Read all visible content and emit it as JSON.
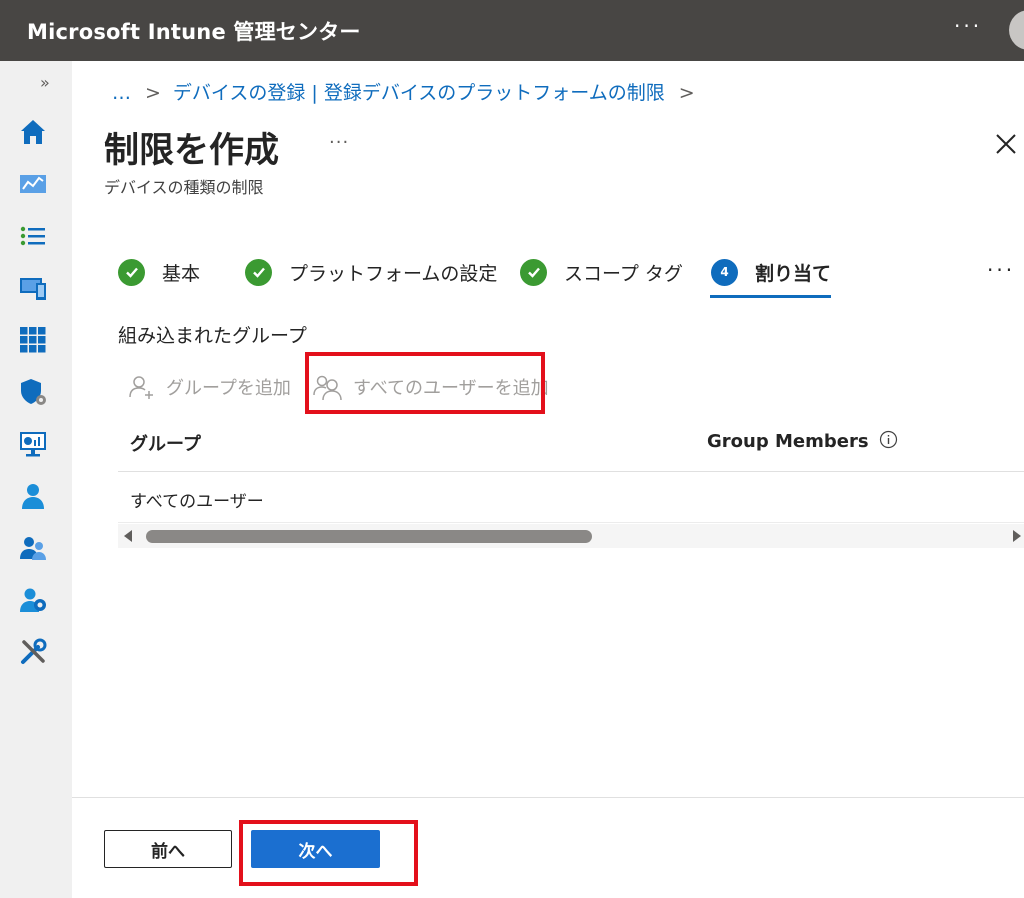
{
  "app": {
    "title": "Microsoft Intune 管理センター",
    "more": "···"
  },
  "nav": {
    "expand": "»",
    "icons": [
      "home-icon",
      "dashboard-icon",
      "all-services-icon",
      "devices-icon",
      "apps-icon",
      "endpoint-security-icon",
      "reports-icon",
      "users-icon",
      "groups-icon",
      "tenant-admin-icon",
      "troubleshooting-icon"
    ]
  },
  "breadcrumb": {
    "ellipsis": "…",
    "sep1": ">",
    "item": "デバイスの登録 | 登録デバイスのプラットフォームの制限",
    "sep2": ">"
  },
  "header": {
    "title": "制限を作成",
    "more": "···",
    "subtitle": "デバイスの種類の制限"
  },
  "steps": [
    {
      "label": "基本",
      "state": "done"
    },
    {
      "label": "プラットフォームの設定",
      "state": "done"
    },
    {
      "label": "スコープ タグ",
      "state": "done"
    },
    {
      "label": "割り当て",
      "state": "current",
      "number": "4"
    }
  ],
  "steps_more": "···",
  "assignments": {
    "section_label": "組み込まれたグループ",
    "add_group": "グループを追加",
    "add_all_users": "すべてのユーザーを追加",
    "columns": [
      "グループ",
      "Group Members"
    ],
    "rows": [
      {
        "group": "すべてのユーザー",
        "members": ""
      }
    ]
  },
  "footer": {
    "prev": "前へ",
    "next": "次へ"
  },
  "colors": {
    "accent": "#0f6cbd",
    "success": "#3b9a32",
    "highlight": "#e3101b",
    "topbar": "#484644"
  }
}
